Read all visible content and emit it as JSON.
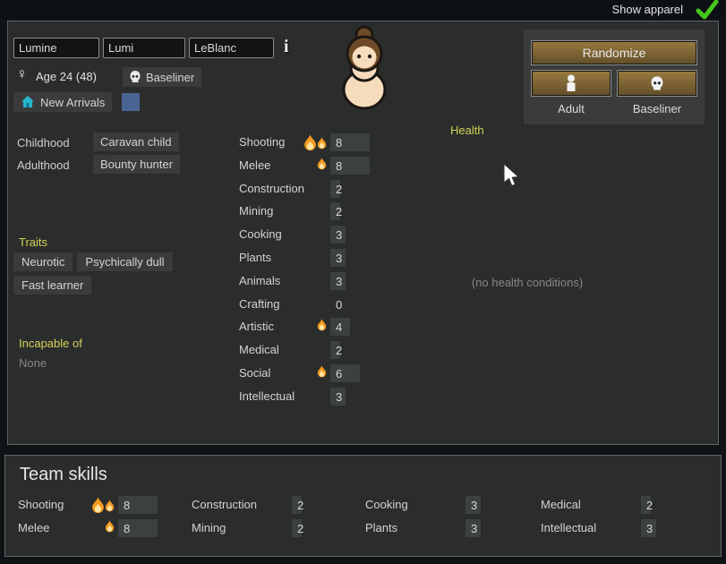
{
  "top_bar": {
    "show_apparel": "Show apparel"
  },
  "names": {
    "first": "Lumine",
    "nick": "Lumi",
    "last": "LeBlanc"
  },
  "bio": {
    "gender_symbol": "♀",
    "age": "Age 24 (48)",
    "xenotype": "Baseliner",
    "faction": "New Arrivals",
    "childhood_label": "Childhood",
    "childhood": "Caravan child",
    "adulthood_label": "Adulthood",
    "adulthood": "Bounty hunter"
  },
  "traits": {
    "header": "Traits",
    "items": [
      "Neurotic",
      "Psychically dull",
      "Fast learner"
    ]
  },
  "incapable": {
    "header": "Incapable of",
    "value": "None"
  },
  "health": {
    "header": "Health",
    "empty": "(no health conditions)"
  },
  "skills": {
    "items": [
      {
        "name": "Shooting",
        "value": 8,
        "passion": 2
      },
      {
        "name": "Melee",
        "value": 8,
        "passion": 1
      },
      {
        "name": "Construction",
        "value": 2,
        "passion": 0
      },
      {
        "name": "Mining",
        "value": 2,
        "passion": 0
      },
      {
        "name": "Cooking",
        "value": 3,
        "passion": 0
      },
      {
        "name": "Plants",
        "value": 3,
        "passion": 0
      },
      {
        "name": "Animals",
        "value": 3,
        "passion": 0
      },
      {
        "name": "Crafting",
        "value": 0,
        "passion": 0
      },
      {
        "name": "Artistic",
        "value": 4,
        "passion": 1
      },
      {
        "name": "Medical",
        "value": 2,
        "passion": 0
      },
      {
        "name": "Social",
        "value": 6,
        "passion": 1
      },
      {
        "name": "Intellectual",
        "value": 3,
        "passion": 0
      }
    ]
  },
  "randomize_panel": {
    "randomize": "Randomize",
    "adult": "Adult",
    "baseliner": "Baseliner"
  },
  "team_skills": {
    "title": "Team skills",
    "columns": [
      [
        {
          "name": "Shooting",
          "value": 8,
          "passion": 2
        },
        {
          "name": "Melee",
          "value": 8,
          "passion": 1
        }
      ],
      [
        {
          "name": "Construction",
          "value": 2,
          "passion": 0
        },
        {
          "name": "Mining",
          "value": 2,
          "passion": 0
        }
      ],
      [
        {
          "name": "Cooking",
          "value": 3,
          "passion": 0
        },
        {
          "name": "Plants",
          "value": 3,
          "passion": 0
        }
      ],
      [
        {
          "name": "Medical",
          "value": 2,
          "passion": 0
        },
        {
          "name": "Intellectual",
          "value": 3,
          "passion": 0
        }
      ]
    ]
  },
  "colors": {
    "accent_yellow": "#d3d356",
    "check_green": "#43c61c",
    "favorite_color": "#4a6493",
    "button_brown_top": "#97783f",
    "button_brown_bottom": "#63502a",
    "house_cyan": "#29b6cf",
    "skin": "#f6dcbd",
    "hair": "#6e4a28"
  }
}
